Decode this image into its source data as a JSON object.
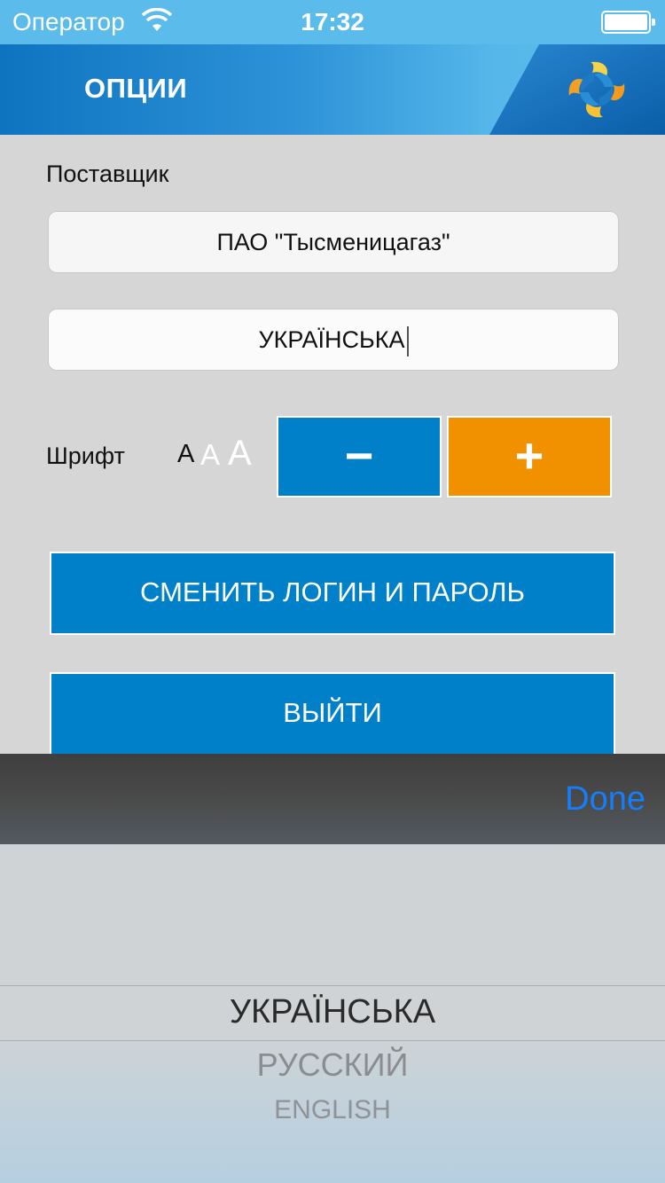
{
  "status_bar": {
    "carrier": "Оператор",
    "time": "17:32",
    "wifi_icon": "wifi-icon",
    "battery_icon": "battery-icon"
  },
  "header": {
    "title": "ОПЦИИ",
    "logo_icon": "app-logo-icon",
    "accent_color": "#0e74c0"
  },
  "supplier": {
    "label": "Поставщик",
    "value": "ПАО \"Тысменицагаз\""
  },
  "language": {
    "value": "УКРАЇНСЬКА"
  },
  "font": {
    "label": "Шрифт",
    "sample_small": "A",
    "sample_medium": "A",
    "sample_large": "A",
    "decrease_label": "−",
    "increase_label": "+",
    "decrease_color": "#0080c8",
    "increase_color": "#f29100"
  },
  "buttons": {
    "change_login": "СМЕНИТЬ ЛОГИН И ПАРОЛЬ",
    "logout": "ВЫЙТИ"
  },
  "toolbar": {
    "done_label": "Done"
  },
  "picker": {
    "options": [
      "УКРАЇНСЬКА",
      "РУССКИЙ",
      "ENGLISH"
    ],
    "selected": "УКРАЇНСЬКА"
  }
}
